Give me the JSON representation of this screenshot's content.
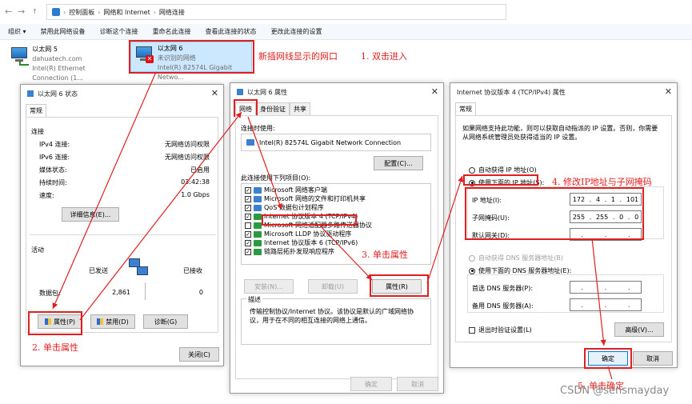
{
  "breadcrumb": {
    "part1": "控制面板",
    "part2": "网络和 Internet",
    "part3": "网络连接"
  },
  "toolbar": [
    "组织 ▾",
    "禁用此网络设备",
    "诊断这个连接",
    "重命名此连接",
    "查看此连接的状态",
    "更改此连接的设置"
  ],
  "adapters": [
    {
      "name": "以太网 5",
      "line2": "dahuatech.com",
      "line3": "Intel(R) Ethernet Connection (1..."
    },
    {
      "name": "以太网 6",
      "line2": "未识别的网络",
      "line3": "Intel(R) 82574L Gigabit Netwo..."
    }
  ],
  "status_dialog": {
    "title": "以太网 6 状态",
    "tab": "常规",
    "conn_header": "连接",
    "rows": [
      {
        "label": "IPv4 连接:",
        "value": "无网络访问权限"
      },
      {
        "label": "IPv6 连接:",
        "value": "无网络访问权限"
      },
      {
        "label": "媒体状态:",
        "value": "已启用"
      },
      {
        "label": "持续时间:",
        "value": "03:42:38"
      },
      {
        "label": "速度:",
        "value": "1.0 Gbps"
      }
    ],
    "details_btn": "详细信息(E)...",
    "activity_header": "活动",
    "sent_label": "已发送",
    "recv_label": "已接收",
    "packets_label": "数据包:",
    "packets_sent": "2,861",
    "packets_recv": "0",
    "props_btn": "属性(P)",
    "disable_btn": "禁用(D)",
    "diagnose_btn": "诊断(G)",
    "close_btn": "关闭(C)"
  },
  "props_dialog": {
    "title": "以太网 6 属性",
    "tabs": [
      "网络",
      "身份验证",
      "共享"
    ],
    "connect_using": "连接时使用:",
    "adapter": "Intel(R) 82574L Gigabit Network Connection",
    "config_btn": "配置(C)...",
    "items_label": "此连接使用下列项目(O):",
    "items": [
      "Microsoft 网络客户端",
      "Microsoft 网络的文件和打印机共享",
      "QoS 数据包计划程序",
      "Internet 协议版本 4 (TCP/IPv4)",
      "Microsoft 网络适配器多路传送器协议",
      "Microsoft LLDP 协议驱动程序",
      "Internet 协议版本 6 (TCP/IPv6)",
      "链路层拓扑发现响应程序"
    ],
    "install_btn": "安装(N)...",
    "uninstall_btn": "卸载(U)",
    "properties_btn": "属性(R)",
    "desc_header": "描述",
    "desc_text": "传输控制协议/Internet 协议。该协议是默认的广域网络协议，用于在不同的相互连接的网络上通信。",
    "ok_btn": "确定",
    "cancel_btn": "取消"
  },
  "ipv4_dialog": {
    "title": "Internet 协议版本 4 (TCP/IPv4) 属性",
    "tab": "常规",
    "intro": "如果网络支持此功能，则可以获取自动指派的 IP 设置。否则，你需要从网络系统管理员处获得适当的 IP 设置。",
    "auto_ip": "自动获得 IP 地址(O)",
    "manual_ip": "使用下面的 IP 地址(S):",
    "ip_label": "IP 地址(I):",
    "ip": [
      "172",
      "4",
      "1",
      "101"
    ],
    "mask_label": "子网掩码(U):",
    "mask": [
      "255",
      "255",
      "0",
      "0"
    ],
    "gw_label": "默认网关(D):",
    "auto_dns": "自动获得 DNS 服务器地址(B)",
    "manual_dns": "使用下面的 DNS 服务器地址(E):",
    "dns1_label": "首选 DNS 服务器(P):",
    "dns2_label": "备用 DNS 服务器(A):",
    "validate": "退出时验证设置(L)",
    "advanced_btn": "高级(V)...",
    "ok_btn": "确定",
    "cancel_btn": "取消"
  },
  "annotations": {
    "a1": "新插网线显示的网口",
    "a2": "1. 双击进入",
    "a3": "2. 单击属性",
    "a4": "3. 单击属性",
    "a5": "4. 修改IP地址与子网掩码",
    "a6": "5. 单击确定"
  },
  "watermark": "CSDN @sensmayday",
  "colors": {
    "annotation": "#e02020",
    "accent": "#0078d7"
  }
}
